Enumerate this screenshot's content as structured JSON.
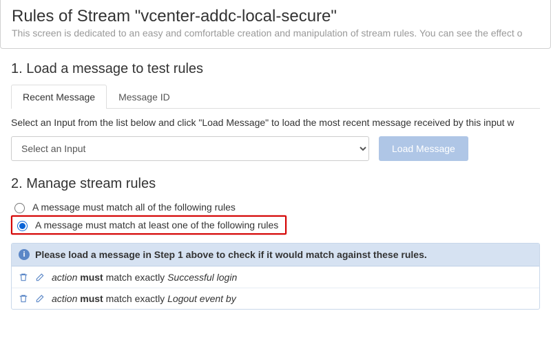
{
  "header": {
    "title_prefix": "Rules of Stream \"",
    "stream_name": "vcenter-addc-local-secure",
    "title_suffix": "\"",
    "subtitle": "This screen is dedicated to an easy and comfortable creation and manipulation of stream rules. You can see the effect o"
  },
  "section1": {
    "title": "1. Load a message to test rules",
    "tabs": {
      "recent": "Recent Message",
      "id": "Message ID"
    },
    "help": "Select an Input from the list below and click \"Load Message\" to load the most recent message received by this input w",
    "select_placeholder": "Select an Input",
    "load_button": "Load Message"
  },
  "section2": {
    "title": "2. Manage stream rules",
    "match_all": "A message must match all of the following rules",
    "match_any": "A message must match at least one of the following rules",
    "panel_hint": "Please load a message in Step 1 above to check if it would match against these rules.",
    "rules": [
      {
        "field": "action",
        "verb": "must",
        "op": "match exactly",
        "value": "Successful login"
      },
      {
        "field": "action",
        "verb": "must",
        "op": "match exactly",
        "value": "Logout event by"
      }
    ]
  }
}
